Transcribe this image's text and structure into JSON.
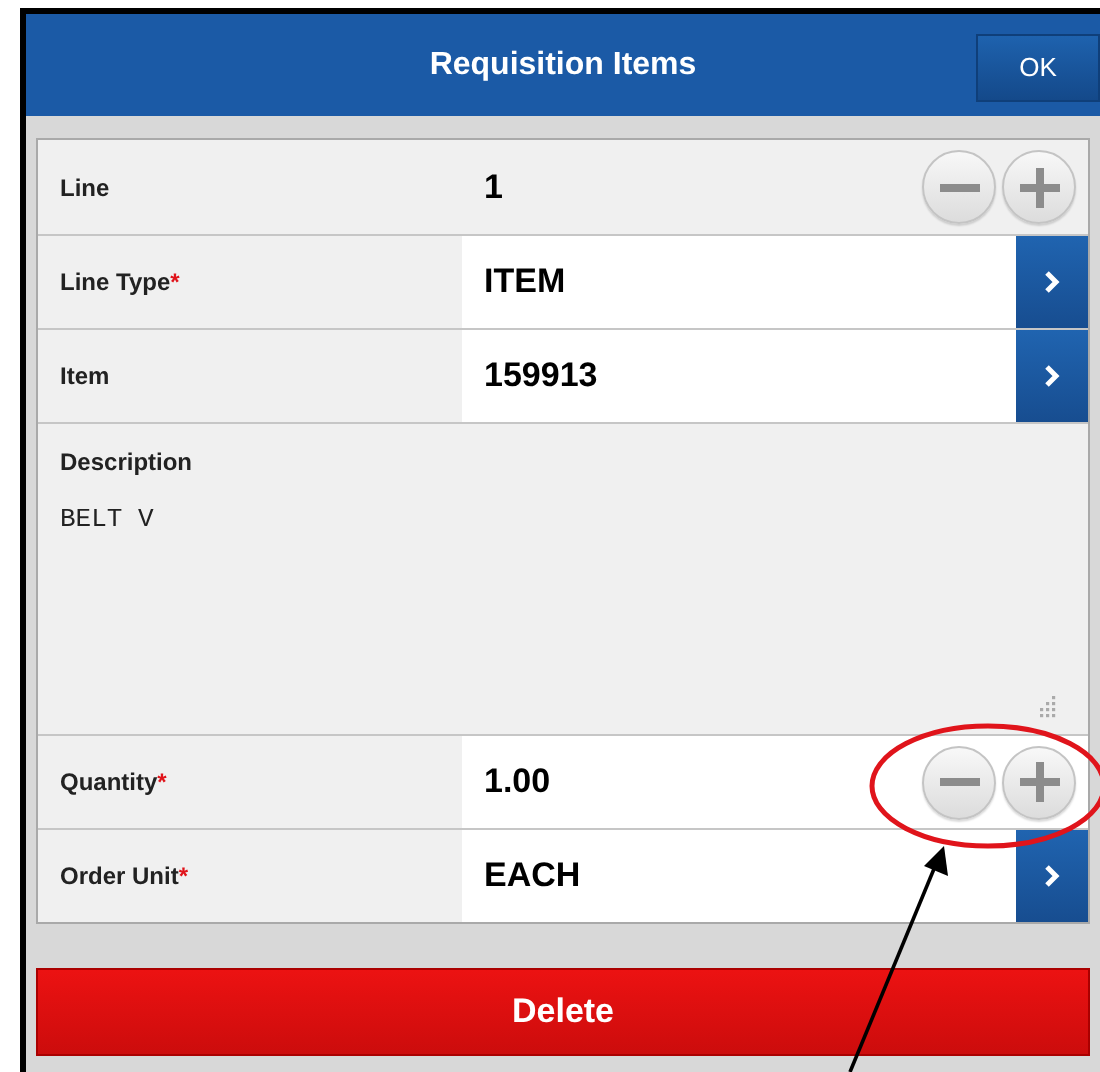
{
  "header": {
    "title": "Requisition Items",
    "ok_button": "OK"
  },
  "fields": [
    {
      "kind": "stepper",
      "label": "Line",
      "editable": false,
      "value": "1"
    },
    {
      "kind": "select",
      "label": "Line Type",
      "required_mark": "*",
      "value": "ITEM"
    },
    {
      "kind": "select",
      "label": "Item",
      "value": "159913"
    },
    {
      "kind": "textarea",
      "label": "Description",
      "value": "BELT V"
    },
    {
      "kind": "stepper",
      "label": "Quantity",
      "required_mark": "*",
      "editable": true,
      "value": "1.00"
    },
    {
      "kind": "select",
      "label": "Order Unit",
      "required_mark": "*",
      "value": "EACH"
    }
  ],
  "delete_button": "Delete"
}
